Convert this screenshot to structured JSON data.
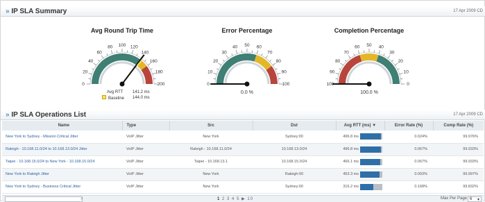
{
  "summary": {
    "title_mark": "»",
    "title": "IP SLA Summary",
    "date": "17 Apr 2009 CD"
  },
  "gauges": [
    {
      "title": "Avg Round Trip Time",
      "ticks": [
        "0",
        "20",
        "40",
        "60",
        "80",
        "100",
        "120",
        "140",
        "160",
        "180",
        "200"
      ],
      "value": 141.2,
      "max": 200,
      "legend_rtt_label": "Avg RTT",
      "legend_rtt_value": "141.2 ms",
      "legend_base_label": "Baseline",
      "legend_base_value": "144.0 ms"
    },
    {
      "title": "Error Percentage",
      "ticks": [
        "0",
        "10",
        "20",
        "30",
        "40",
        "50",
        "60",
        "70",
        "80",
        "90",
        "100"
      ],
      "value": 0.0,
      "max": 100,
      "readout": "0.0 %"
    },
    {
      "title": "Completion Percentage",
      "ticks": [
        "100",
        "90",
        "80",
        "70",
        "60",
        "50",
        "40",
        "30",
        "20",
        "10",
        "0"
      ],
      "value": 100.0,
      "max": 100,
      "readout": "100.0 %"
    }
  ],
  "ops": {
    "title_mark": "»",
    "title": "IP SLA Operations List",
    "date": "17 Apr 2009 CD",
    "columns": [
      "Name",
      "Type",
      "Src",
      "Dst",
      "Avg RTT (ms)",
      "Error Rate (%)",
      "Comp Rate (%)"
    ],
    "sort_icon": "sort-desc-icon",
    "rows": [
      {
        "name": "New York to Sydney - Mission Critical Jitter",
        "type": "VoIP Jitter",
        "src": "New York",
        "dst": "Sydney:00",
        "rtt": "496.8 ms",
        "rtt_fill": 0.95,
        "err": "0.024%",
        "comp": "99.976%"
      },
      {
        "name": "Raleigh - 10.168.11.0/24 to 10.168.13.0/24 Jitter",
        "type": "VoIP Jitter",
        "src": "Raleigh - 10.168.11.0/24",
        "dst": "10.168.13.0/24",
        "rtt": "496.8 ms",
        "rtt_fill": 0.95,
        "err": "0.067%",
        "comp": "99.933%"
      },
      {
        "name": "Taipei - 10.168.15.0/24 to New York - 10.168.15.0/24",
        "type": "VoIP Jitter",
        "src": "Taipei - 10.168.13.1",
        "dst": "10.168.15.0/24",
        "rtt": "466.1 ms",
        "rtt_fill": 0.9,
        "err": "0.067%",
        "comp": "99.933%"
      },
      {
        "name": "New York to Raleigh Jitter",
        "type": "VoIP Jitter",
        "src": "New York",
        "dst": "Raleigh:00",
        "rtt": "453.3 ms",
        "rtt_fill": 0.87,
        "err": "0.003%",
        "comp": "99.997%"
      },
      {
        "name": "New York to Sydney - Business Critical Jitter",
        "type": "VoIP Jitter",
        "src": "New York",
        "dst": "Sydney:00",
        "rtt": "316.2 ms",
        "rtt_fill": 0.6,
        "err": "0.168%",
        "comp": "99.832%"
      }
    ]
  },
  "footer": {
    "search_icon": "search-icon",
    "pages": [
      "1",
      "2",
      "3",
      "4",
      "5",
      "▶",
      "10"
    ],
    "max_per_page_label": "Max Per Page",
    "max_per_page_value": "6"
  },
  "colors": {
    "accent": "#2f6fa8",
    "gauge_band": "#3f7f74",
    "gauge_yellow": "#e3b72a",
    "gauge_red": "#b8453c"
  }
}
